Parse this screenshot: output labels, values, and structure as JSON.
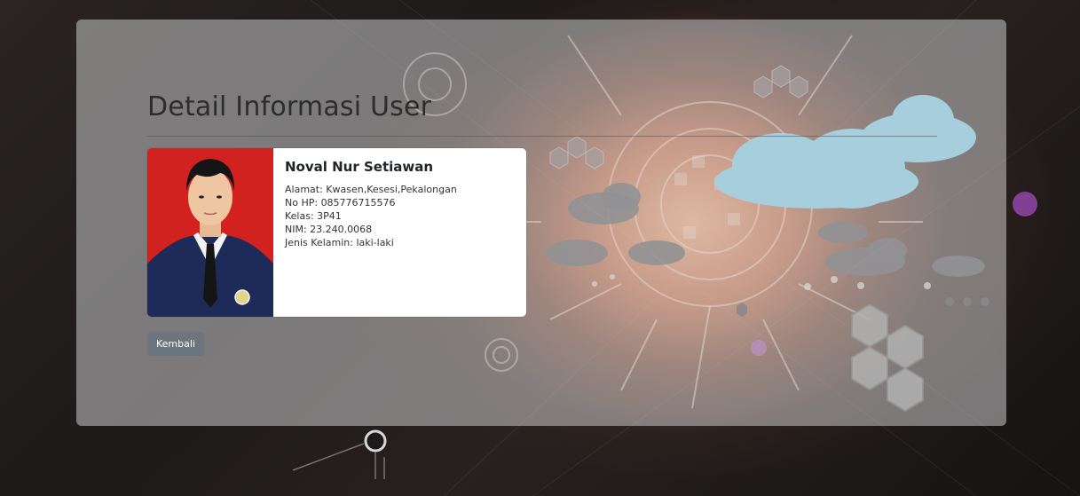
{
  "page": {
    "title": "Detail Informasi User"
  },
  "user": {
    "name": "Noval Nur Setiawan",
    "address": "Alamat: Kwasen,Kesesi,Pekalongan",
    "phone": "No HP: 085776715576",
    "class": "Kelas: 3P41",
    "nim": "NIM: 23.240.0068",
    "gender": "Jenis Kelamin: laki-laki"
  },
  "actions": {
    "back_label": "Kembali"
  },
  "colors": {
    "panel": "#c8c8c8",
    "button": "#6c757d",
    "photo_bg": "#d1221f",
    "cloud": "#7fd6f5"
  }
}
